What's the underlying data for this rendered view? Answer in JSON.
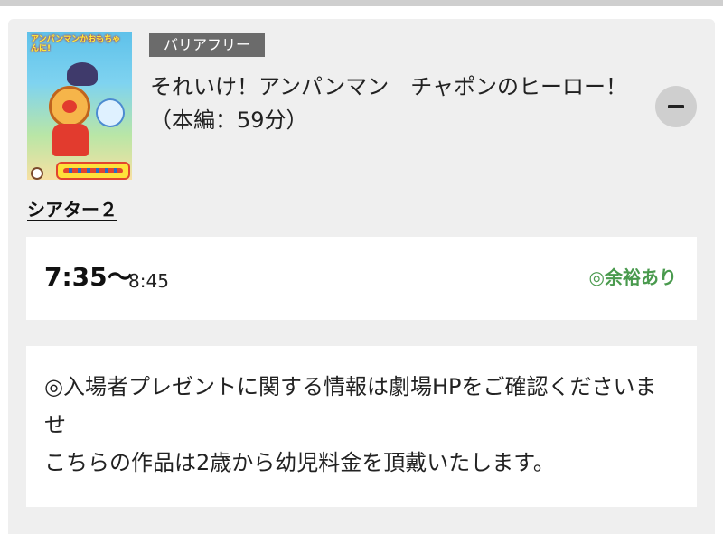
{
  "movie": {
    "poster_text": "アンパンマンかおもちゃんに!",
    "badge": "バリアフリー",
    "title": "それいけ！アンパンマン　チャポンのヒーロー！（本編：59分）"
  },
  "theater": {
    "name": "シアター２"
  },
  "showtime": {
    "start": "7:35〜",
    "end": "8:45",
    "availability": "◎余裕あり"
  },
  "notice": {
    "line1": "◎入場者プレゼントに関する情報は劇場HPをご確認くださいませ",
    "line2": "こちらの作品は2歳から幼児料金を頂戴いたします。"
  },
  "icons": {
    "collapse": "minus-icon"
  },
  "colors": {
    "card_bg": "#efefef",
    "badge_bg": "#6b6b6b",
    "availability": "#4a9a4e",
    "button_bg": "#cfcfcf"
  }
}
